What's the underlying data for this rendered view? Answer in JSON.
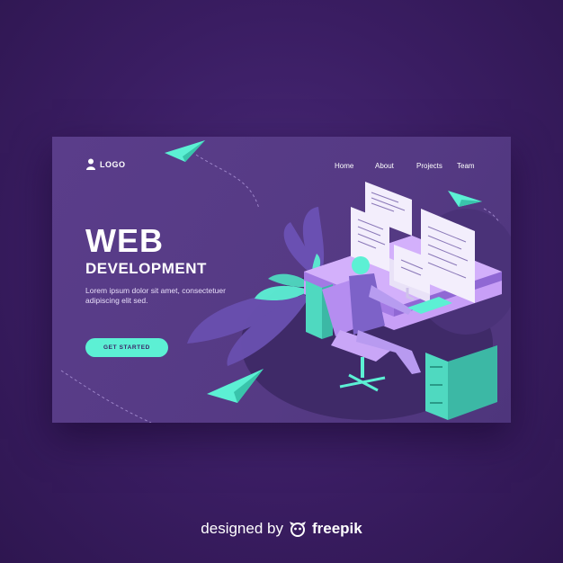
{
  "header": {
    "logo_text": "LOGO",
    "nav": [
      {
        "label": "Home"
      },
      {
        "label": "About"
      },
      {
        "label": "Projects"
      },
      {
        "label": "Team"
      }
    ]
  },
  "hero": {
    "title": "WEB",
    "subtitle": "DEVELOPMENT",
    "description": "Lorem ipsum dolor sit amet, consectetuer adipiscing elit sed.",
    "cta_label": "GET STARTED"
  },
  "credit": {
    "prefix": "designed by",
    "brand": "freepik"
  },
  "colors": {
    "background": "#3a1d62",
    "card": "#553a84",
    "accent": "#5cf0d4",
    "desk": "#b58df0"
  },
  "icons": {
    "logo": "user-icon",
    "credit": "freepik-icon",
    "plane": "paper-plane-icon"
  }
}
